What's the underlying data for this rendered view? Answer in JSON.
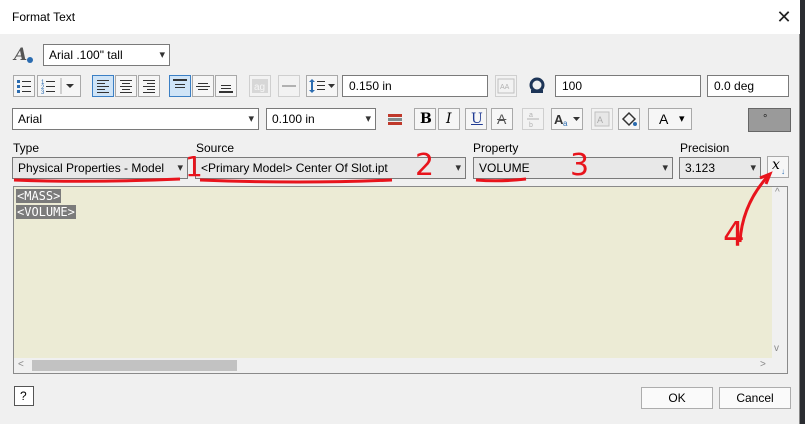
{
  "window": {
    "title": "Format Text",
    "close_glyph": "✕"
  },
  "row1": {
    "style_value": "Arial .100\" tall",
    "line_spacing_value": "0.150 in",
    "width_scale_value": "100",
    "rotation_value": "0.0 deg"
  },
  "row2": {
    "font_value": "Arial",
    "font_size_value": "0.100 in",
    "bold": "B",
    "italic": "I",
    "underline": "U",
    "strike": "A",
    "caps_glyph": "A",
    "color_glyph": "A",
    "symbol_glyph": "°"
  },
  "params": {
    "type_label": "Type",
    "type_value": "Physical Properties - Model",
    "source_label": "Source",
    "source_value": "<Primary Model> Center Of Slot.ipt",
    "property_label": "Property",
    "property_value": "VOLUME",
    "precision_label": "Precision",
    "precision_value": "3.123",
    "insert_glyph": "x"
  },
  "editor": {
    "lines": [
      "<MASS>",
      "<VOLUME>"
    ]
  },
  "footer": {
    "help_glyph": "?",
    "ok": "OK",
    "cancel": "Cancel"
  },
  "annotations": {
    "n1": "1",
    "n2": "2",
    "n3": "3",
    "n4": "4",
    "color": "#e8141c"
  },
  "icons": [
    "text-style-icon",
    "bullet-list-icon",
    "numbered-list-icon",
    "align-left-icon",
    "align-center-icon",
    "align-right-icon",
    "align-top-icon",
    "align-middle-icon",
    "align-bottom-icon",
    "stacking-icon",
    "strikeline-icon",
    "line-spacing-icon",
    "width-scale-icon",
    "oblique-icon",
    "stack-icon",
    "case-icon",
    "background-fill-icon",
    "color-icon",
    "symbol-icon",
    "insert-parameter-icon",
    "help-icon"
  ]
}
